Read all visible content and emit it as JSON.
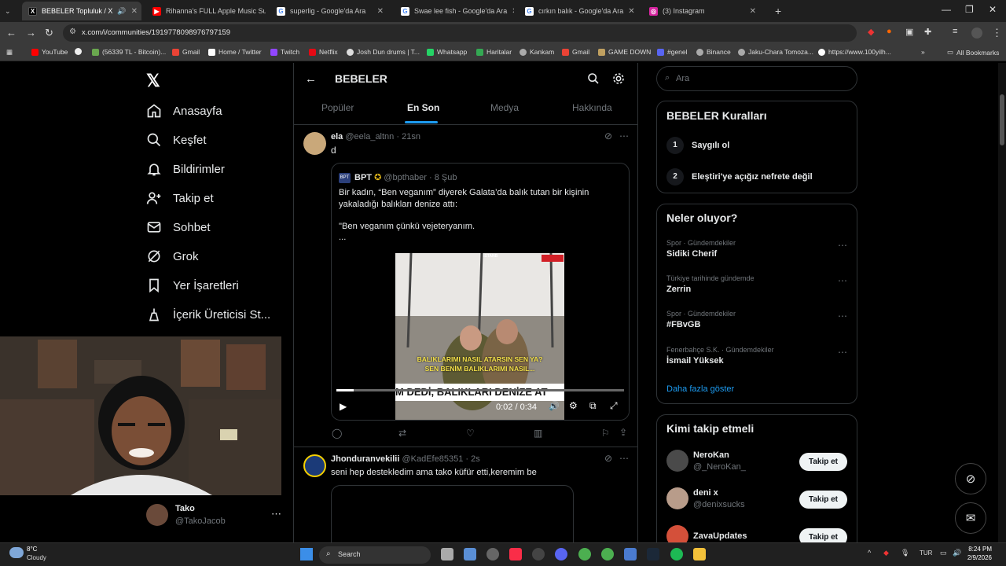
{
  "browser": {
    "tabs": [
      {
        "label": "BEBELER Topluluk / X",
        "color": "#000000",
        "glyph": "X"
      },
      {
        "label": "Rihanna's FULL Apple Music Su",
        "color": "#ff0000",
        "glyph": "▶"
      },
      {
        "label": "superlig - Google'da Ara",
        "color": "#4285f4",
        "glyph": "G"
      },
      {
        "label": "Swae lee fish - Google'da Ara",
        "color": "#4285f4",
        "glyph": "G"
      },
      {
        "label": "cırkın balık - Google'da Ara",
        "color": "#4285f4",
        "glyph": "G"
      },
      {
        "label": "(3) Instagram",
        "color": "#d6249f",
        "glyph": "◎"
      }
    ],
    "url": "x.com/i/communities/1919778098976797159",
    "bookmarks": [
      {
        "label": "YouTube",
        "color": "#ff0000"
      },
      {
        "label": "(56339 TL - Bitcoin)...",
        "color": "#6aa84f"
      },
      {
        "label": "Gmail",
        "color": "#ea4335"
      },
      {
        "label": "Home / Twitter",
        "color": "#ffffff"
      },
      {
        "label": "Twitch",
        "color": "#9146ff"
      },
      {
        "label": "Netflix",
        "color": "#e50914"
      },
      {
        "label": "Josh Dun drums | T...",
        "color": "#dddddd"
      },
      {
        "label": "Whatsapp",
        "color": "#25d366"
      },
      {
        "label": "Haritalar",
        "color": "#34a853"
      },
      {
        "label": "Kankam",
        "color": "#aaaaaa"
      },
      {
        "label": "Gmail",
        "color": "#ea4335"
      },
      {
        "label": "GAME DOWN",
        "color": "#c0a060"
      },
      {
        "label": "#genel",
        "color": "#5865f2"
      },
      {
        "label": "Binance",
        "color": "#aaaaaa"
      },
      {
        "label": "Jaku-Chara Tomoza...",
        "color": "#aaaaaa"
      },
      {
        "label": "https://www.100yilh...",
        "color": "#ffffff"
      }
    ],
    "all_bookmarks": "All Bookmarks"
  },
  "sidebar": {
    "items": [
      {
        "label": "Anasayfa",
        "icon": "home-icon"
      },
      {
        "label": "Keşfet",
        "icon": "search-icon"
      },
      {
        "label": "Bildirimler",
        "icon": "bell-icon"
      },
      {
        "label": "Takip et",
        "icon": "person-add-icon"
      },
      {
        "label": "Sohbet",
        "icon": "mail-icon"
      },
      {
        "label": "Grok",
        "icon": "grok-icon"
      },
      {
        "label": "Yer İşaretleri",
        "icon": "bookmark-icon"
      },
      {
        "label": "İçerik Üreticisi St...",
        "icon": "creator-icon"
      }
    ],
    "profile": {
      "name": "Tako",
      "handle": "@TakoJacob"
    }
  },
  "header": {
    "title": "BEBELER"
  },
  "tabs": [
    {
      "label": "Popüler",
      "active": false
    },
    {
      "label": "En Son",
      "active": true
    },
    {
      "label": "Medya",
      "active": false
    },
    {
      "label": "Hakkında",
      "active": false
    }
  ],
  "post1": {
    "name": "ela",
    "handle": "@eela_altnn",
    "time": "· 21sn",
    "text": "d",
    "quote": {
      "name": "BPT",
      "handle": "@bpthaber",
      "time": "· 8 Şub",
      "text1": "Bir kadın, “Ben veganım” diyerek Galata’da balık tutan bir kişinin yakaladığı balıkları denize attı:",
      "text2": "\"Ben veganım çünkü vejeteryanım.",
      "more": "..."
    },
    "video": {
      "time": "0:02 / 0:34",
      "progress": 0.06,
      "caption1": "BALIKLARIMI NASIL ATARSIN SEN YA?",
      "caption2": "SEN BENİM BALIKLARIMI NASIL...",
      "caption3": "M DEDİ, BALIKLARI DENİZE AT",
      "badge": "İSTANB"
    }
  },
  "post2": {
    "name": "Jhonduranvekilii",
    "handle": "@KadEfe85351",
    "time": "· 2s",
    "text": "seni hep destekledim ama tako küfür etti,keremim be"
  },
  "right": {
    "search_placeholder": "Ara",
    "rules_title": "BEBELER Kuralları",
    "rules": [
      {
        "num": "1",
        "text": "Saygılı ol"
      },
      {
        "num": "2",
        "text": "Eleştiri'ye açığız nefrete değil"
      }
    ],
    "trends_title": "Neler oluyor?",
    "trends": [
      {
        "category": "Spor · Gündemdekiler",
        "title": "Sidiki Cherif"
      },
      {
        "category": "Türkiye tarihinde gündemde",
        "title": "Zerrin"
      },
      {
        "category": "Spor · Gündemdekiler",
        "title": "#FBvGB"
      },
      {
        "category": "Fenerbahçe S.K. · Gündemdekiler",
        "title": "İsmail Yüksek"
      }
    ],
    "show_more": "Daha fazla göster",
    "follow_title": "Kimi takip etmeli",
    "follow": [
      {
        "name": "NeroKan",
        "handle": "@_NeroKan_",
        "button": "Takip et"
      },
      {
        "name": "deni x",
        "handle": "@denixsucks",
        "button": "Takip et"
      },
      {
        "name": "ZavaUpdates",
        "handle": "",
        "button": "Takip et"
      }
    ]
  },
  "taskbar": {
    "weather_temp": "8°C",
    "weather_desc": "Cloudy",
    "search": "Search",
    "lang": "TUR",
    "time": "8:24 PM",
    "date": "2/9/2026"
  },
  "colors": {
    "accent": "#1d9bf0",
    "bg": "#000000",
    "border": "#2f3336",
    "muted": "#71767b"
  }
}
